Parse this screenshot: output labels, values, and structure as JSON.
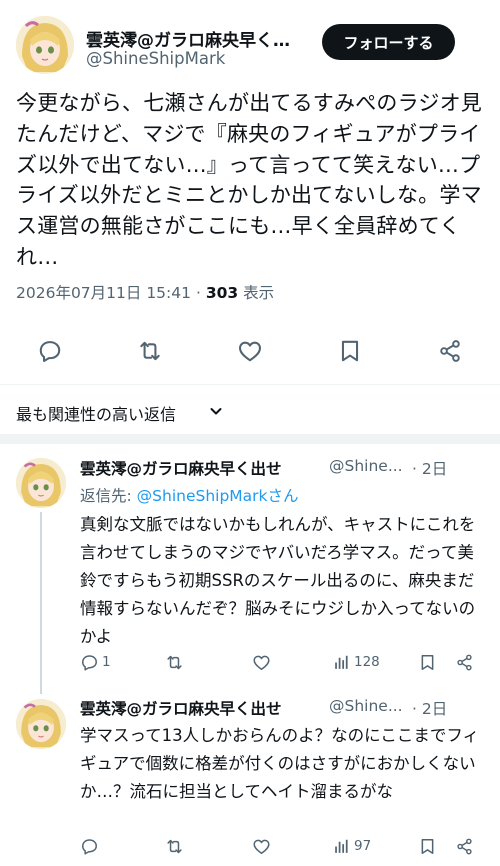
{
  "tweet": {
    "author_name": "雲英澪@ガラロ麻央早く…",
    "author_handle": "@ShineShipMark",
    "follow_label": "フォローする",
    "text": "今更ながら、七瀬さんが出てるすみぺのラジオ見たんだけど、マジで『麻央のフィギュアがプライズ以外で出てない…』って言ってて笑えない…プライズ以外だとミニとかしか出てないしな。学マス運営の無能さがここにも…早く全員辞めてくれ…",
    "timestamp": "2026年07月11日 15:41",
    "separator": "·",
    "views_count": "303",
    "views_label": "表示"
  },
  "actions": [
    "reply-icon",
    "retweet-icon",
    "like-icon",
    "bookmark-icon",
    "share-icon"
  ],
  "sort": {
    "label": "最も関連性の高い返信"
  },
  "replies": [
    {
      "author_name": "雲英澪@ガラロ麻央早く出せ",
      "author_handle": "@Shine...",
      "time": "· 2日",
      "reply_to_prefix": "返信先: ",
      "reply_to_handle": "@ShineShipMarkさん",
      "text": "真剣な文脈ではないかもしれんが、キャストにこれを言わせてしまうのマジでヤバいだろ学マス。だって美鈴ですらもう初期SSRのスケール出るのに、麻央まだ情報すらないんだぞ？脳みそにウジしか入ってないのかよ",
      "reply_count": "1",
      "retweet_count": "",
      "like_count": "",
      "views": "128"
    },
    {
      "author_name": "雲英澪@ガラロ麻央早く出せ",
      "author_handle": "@Shine...",
      "time": "· 2日",
      "text": "学マスって13人しかおらんのよ？なのにここまでフィギュアで個数に格差が付くのはさすがにおかしくないか…？流石に担当としてヘイト溜まるがな",
      "reply_count": "",
      "retweet_count": "",
      "like_count": "",
      "views": "97"
    }
  ],
  "colors": {
    "text": "#0f1419",
    "secondary": "#536471",
    "link": "#1d9bf0",
    "divider": "#eff3f4"
  }
}
